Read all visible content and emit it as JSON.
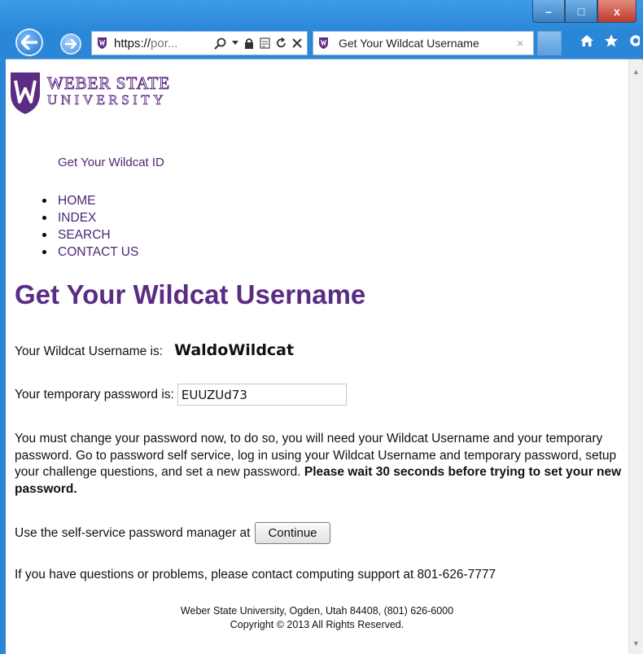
{
  "browser": {
    "address_url_prefix": "https://",
    "address_url_rest": "por...",
    "tab_title": "Get Your Wildcat Username",
    "tab_close": "×",
    "window_controls": {
      "minimize": "–",
      "maximize": "□",
      "close": "x"
    }
  },
  "site": {
    "logo_line1": "WEBER STATE",
    "logo_line2": "UNIVERSITY",
    "tagline": "Get Your Wildcat ID",
    "nav": [
      "HOME",
      "INDEX",
      "SEARCH",
      "CONTACT US"
    ]
  },
  "content": {
    "page_title": "Get Your Wildcat Username",
    "username_label": "Your Wildcat Username is:",
    "username_value": "WaldoWildcat",
    "password_label": "Your temporary password is:",
    "password_value": "EUUZUd73",
    "instructions": "You must change your password now, to do so, you will need your Wildcat Username and your temporary password. Go to password self service, log in using your Wildcat Username and temporary password, setup your challenge questions, and set a new password. ",
    "instructions_bold": "Please wait 30 seconds before trying to set your new password.",
    "self_service_label": "Use the self-service password manager at",
    "continue_label": "Continue",
    "support_text": "If you have questions or problems, please contact computing support at 801-626-7777"
  },
  "footer": {
    "line1": "Weber State University, Ogden, Utah 84408, (801) 626-6000",
    "line2": "Copyright © 2013 All Rights Reserved."
  },
  "colors": {
    "brand_purple": "#5b2c83",
    "link_purple": "#4b2774",
    "chrome_blue": "#2a86d6"
  }
}
